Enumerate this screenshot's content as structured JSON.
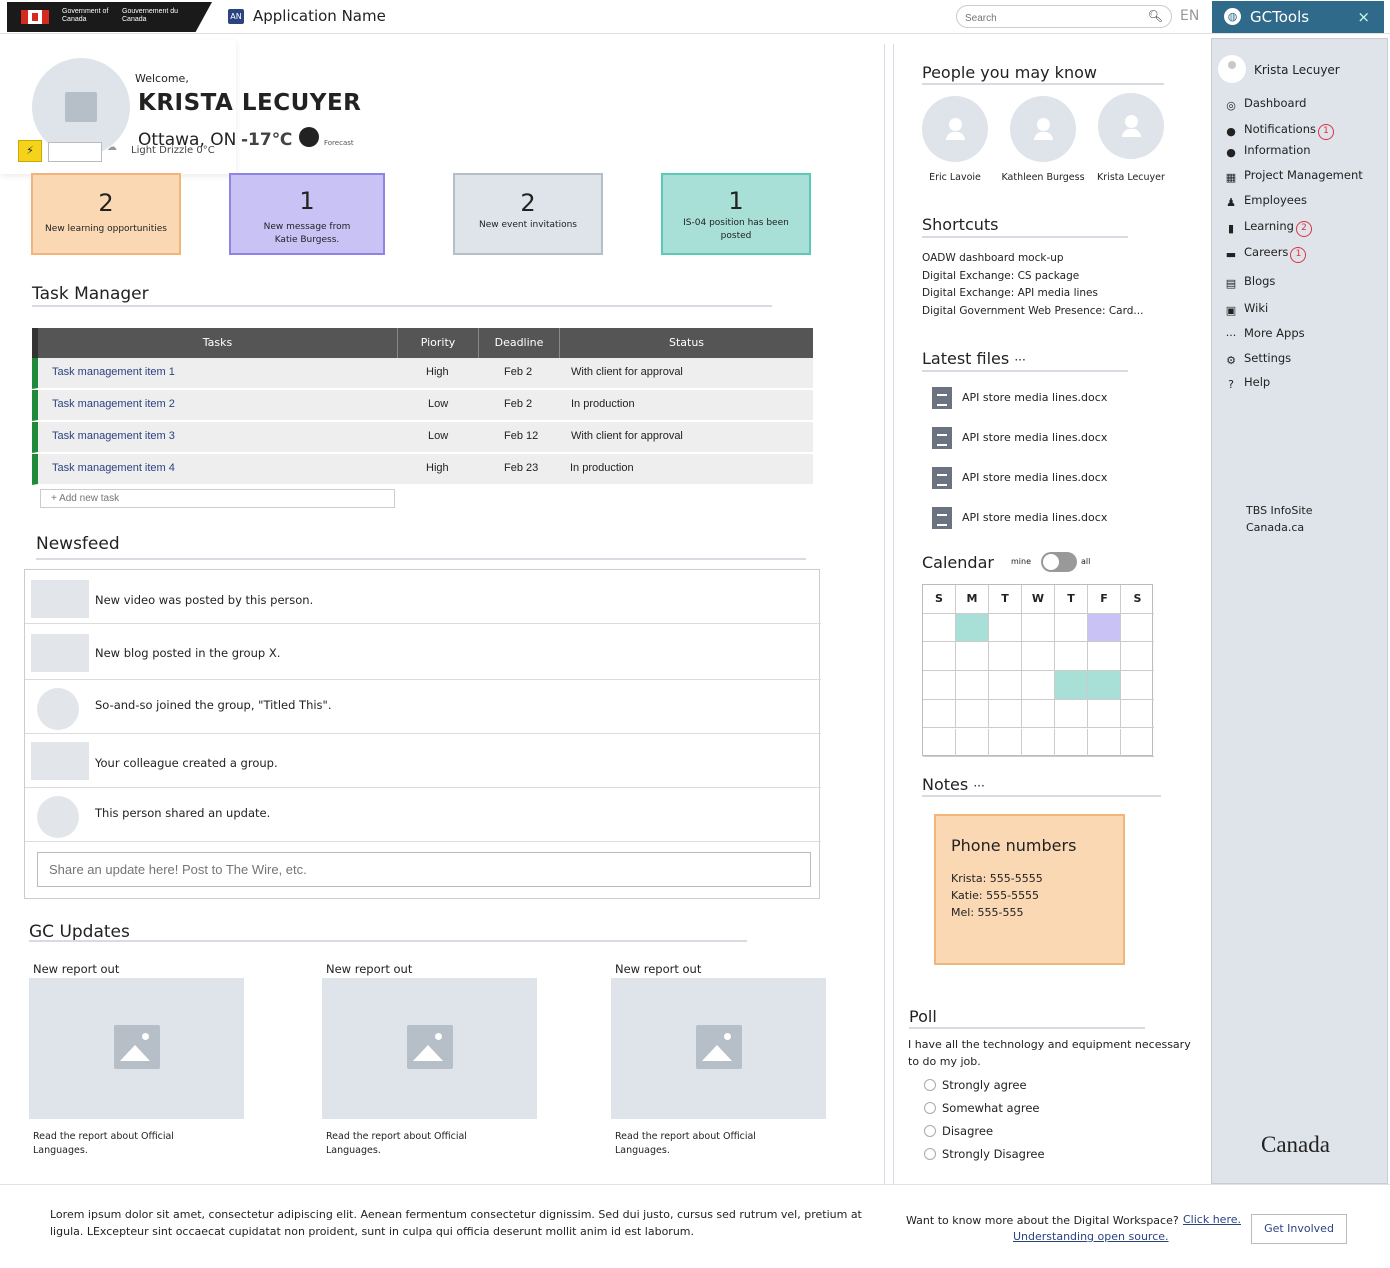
{
  "header": {
    "gov_en": "Government of Canada",
    "gov_fr": "Gouvernement du Canada",
    "app_icon": "AN",
    "app_name": "Application Name",
    "search_placeholder": "Search",
    "lang": "EN",
    "gctools": "GCTools",
    "close": "×"
  },
  "welcome": {
    "greeting": "Welcome,",
    "name": "KRISTA LECUYER",
    "location": "Ottawa, ON",
    "temp": "-17℃",
    "forecast": "Forecast",
    "condition": "Light Drizzle 0°C"
  },
  "cards": [
    {
      "count": "2",
      "text": "New learning opportunities",
      "color": "#fbd8b4"
    },
    {
      "count": "1",
      "text": "New message from Katie Burgess.",
      "color": "#c9c2f5"
    },
    {
      "count": "2",
      "text": "New event invitations",
      "color": "#dfe4ea"
    },
    {
      "count": "1",
      "text": "IS-04 position has been posted",
      "color": "#a8e0d8"
    }
  ],
  "task_manager": {
    "title": "Task Manager",
    "headers": [
      "Tasks",
      "Piority",
      "Deadline",
      "Status"
    ],
    "rows": [
      {
        "task": "Task management item 1",
        "priority": "High",
        "deadline": "Feb 2",
        "status": "With client for approval"
      },
      {
        "task": "Task management item  2",
        "priority": "Low",
        "deadline": "Feb 2",
        "status": "In production"
      },
      {
        "task": "Task management item 3",
        "priority": "Low",
        "deadline": "Feb 12",
        "status": "With client for approval"
      },
      {
        "task": "Task management item 4",
        "priority": "High",
        "deadline": "Feb 23",
        "status": "In production"
      }
    ],
    "add_placeholder": "+ Add new task"
  },
  "newsfeed": {
    "title": "Newsfeed",
    "items": [
      "New video was posted by this person.",
      "New blog posted in the group X.",
      "So-and-so joined the group, \"Titled This\".",
      "Your colleague created a group.",
      "This person shared an update."
    ],
    "share_placeholder": "Share an update here! Post to The Wire, etc."
  },
  "gc_updates": {
    "title": "GC Updates",
    "items": [
      {
        "title": "New report out",
        "caption": "Read the report about Official Languages."
      },
      {
        "title": "New report out",
        "caption": "Read the report about Official Languages."
      },
      {
        "title": "New report out",
        "caption": "Read the report about Official Languages."
      }
    ]
  },
  "people": {
    "title": "People you may know",
    "names": [
      "Eric Lavoie",
      "Kathleen Burgess",
      "Krista Lecuyer"
    ]
  },
  "shortcuts": {
    "title": "Shortcuts",
    "items": [
      "OADW dashboard mock-up",
      "Digital Exchange: CS package",
      "Digital Exchange: API media lines",
      "Digital Government Web Presence: Card..."
    ]
  },
  "latest_files": {
    "title": "Latest files",
    "more": "···",
    "items": [
      "API store media lines.docx",
      "API store media lines.docx",
      "API store media lines.docx",
      "API store media lines.docx"
    ]
  },
  "calendar": {
    "title": "Calendar",
    "toggle_mine": "mine",
    "toggle_all": "all",
    "days": [
      "S",
      "M",
      "T",
      "W",
      "T",
      "F",
      "S"
    ],
    "highlights": [
      {
        "row": 1,
        "col": 1,
        "color": "#a8e0d8"
      },
      {
        "row": 1,
        "col": 5,
        "color": "#c9c2f5"
      },
      {
        "row": 3,
        "col": 4,
        "color": "#a8e0d8"
      },
      {
        "row": 3,
        "col": 5,
        "color": "#a8e0d8"
      }
    ]
  },
  "notes": {
    "title": "Notes",
    "more": "···",
    "card_title": "Phone numbers",
    "lines": [
      "Krista: 555-5555",
      "Katie: 555-5555",
      "Mel: 555-555"
    ]
  },
  "poll": {
    "title": "Poll",
    "question": "I have all the technology and equipment necessary to do my job.",
    "options": [
      "Strongly agree",
      "Somewhat agree",
      "Disagree",
      "Strongly Disagree"
    ]
  },
  "sidebar": {
    "user": "Krista Lecuyer",
    "items": [
      {
        "label": "Dashboard",
        "icon": "dashboard-icon",
        "badge": ""
      },
      {
        "label": "Notifications",
        "icon": "bell-icon",
        "badge": "1"
      },
      {
        "label": "Information",
        "icon": "info-icon",
        "badge": ""
      },
      {
        "label": "Project Management",
        "icon": "grid-icon",
        "badge": ""
      },
      {
        "label": "Employees",
        "icon": "user-icon",
        "badge": ""
      },
      {
        "label": "Learning",
        "icon": "book-icon",
        "badge": "2"
      },
      {
        "label": "Careers",
        "icon": "briefcase-icon",
        "badge": "1"
      },
      {
        "label": "Blogs",
        "icon": "document-icon",
        "badge": ""
      },
      {
        "label": "Wiki",
        "icon": "wiki-icon",
        "badge": ""
      },
      {
        "label": "More Apps",
        "icon": "more-icon",
        "badge": ""
      },
      {
        "label": "Settings",
        "icon": "gear-icon",
        "badge": ""
      },
      {
        "label": "Help",
        "icon": "help-icon",
        "badge": ""
      }
    ],
    "links": [
      "TBS InfoSite",
      "Canada.ca"
    ],
    "wordmark": "Canada"
  },
  "footer": {
    "text": "Lorem ipsum dolor sit amet, consectetur adipiscing elit. Aenean fermentum consectetur dignissim. Sed dui justo, cursus sed rutrum vel, pretium at ligula. LExcepteur sint occaecat cupidatat non proident, sunt in culpa qui officia deserunt mollit anim id est laborum.",
    "more_text": "Want to know more about the Digital Workspace?",
    "click_here": "Click here.",
    "open_source": "Understanding open source.",
    "button": "Get Involved"
  }
}
